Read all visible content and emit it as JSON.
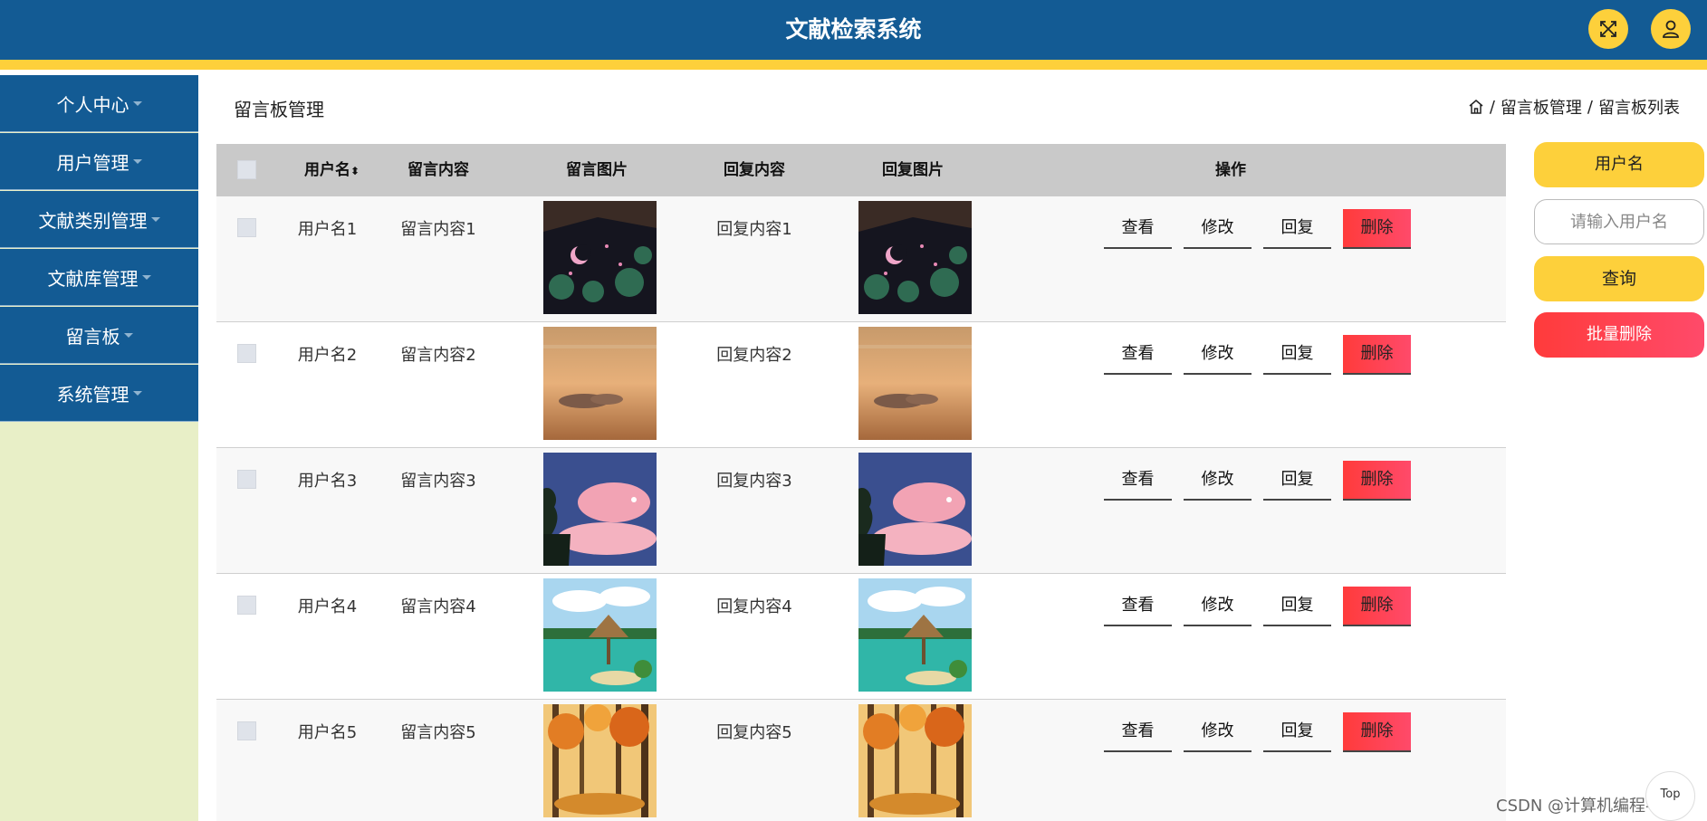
{
  "header": {
    "title": "文献检索系统",
    "fullscreen_icon": "expand-icon",
    "user_icon": "user-icon",
    "brand_color": "#135b94",
    "accent_color": "#fdd03b"
  },
  "sidebar": {
    "items": [
      {
        "label": "个人中心"
      },
      {
        "label": "用户管理"
      },
      {
        "label": "文献类别管理"
      },
      {
        "label": "文献库管理"
      },
      {
        "label": "留言板"
      },
      {
        "label": "系统管理"
      }
    ]
  },
  "page": {
    "title": "留言板管理",
    "breadcrumb": [
      "留言板管理",
      "留言板列表"
    ],
    "breadcrumb_sep": "/"
  },
  "table": {
    "columns": [
      "用户名",
      "留言内容",
      "留言图片",
      "回复内容",
      "回复图片",
      "操作"
    ],
    "rows": [
      {
        "username": "用户名1",
        "content": "留言内容1",
        "reply": "回复内容1",
        "image": "night-moon-garden"
      },
      {
        "username": "用户名2",
        "content": "留言内容2",
        "reply": "回复内容2",
        "image": "sunset-clouds"
      },
      {
        "username": "用户名3",
        "content": "留言内容3",
        "reply": "回复内容3",
        "image": "pink-clouds-tree"
      },
      {
        "username": "用户名4",
        "content": "留言内容4",
        "reply": "回复内容4",
        "image": "tropical-beach-hut"
      },
      {
        "username": "用户名5",
        "content": "留言内容5",
        "reply": "回复内容5",
        "image": "autumn-forest"
      }
    ],
    "actions": {
      "view": "查看",
      "edit": "修改",
      "reply": "回复",
      "delete": "删除"
    }
  },
  "search": {
    "label": "用户名",
    "placeholder": "请输入用户名",
    "search_button": "查询",
    "batch_delete_button": "批量删除"
  },
  "misc": {
    "top_label": "Top",
    "watermark": "CSDN @计算机编程-吉哥"
  }
}
